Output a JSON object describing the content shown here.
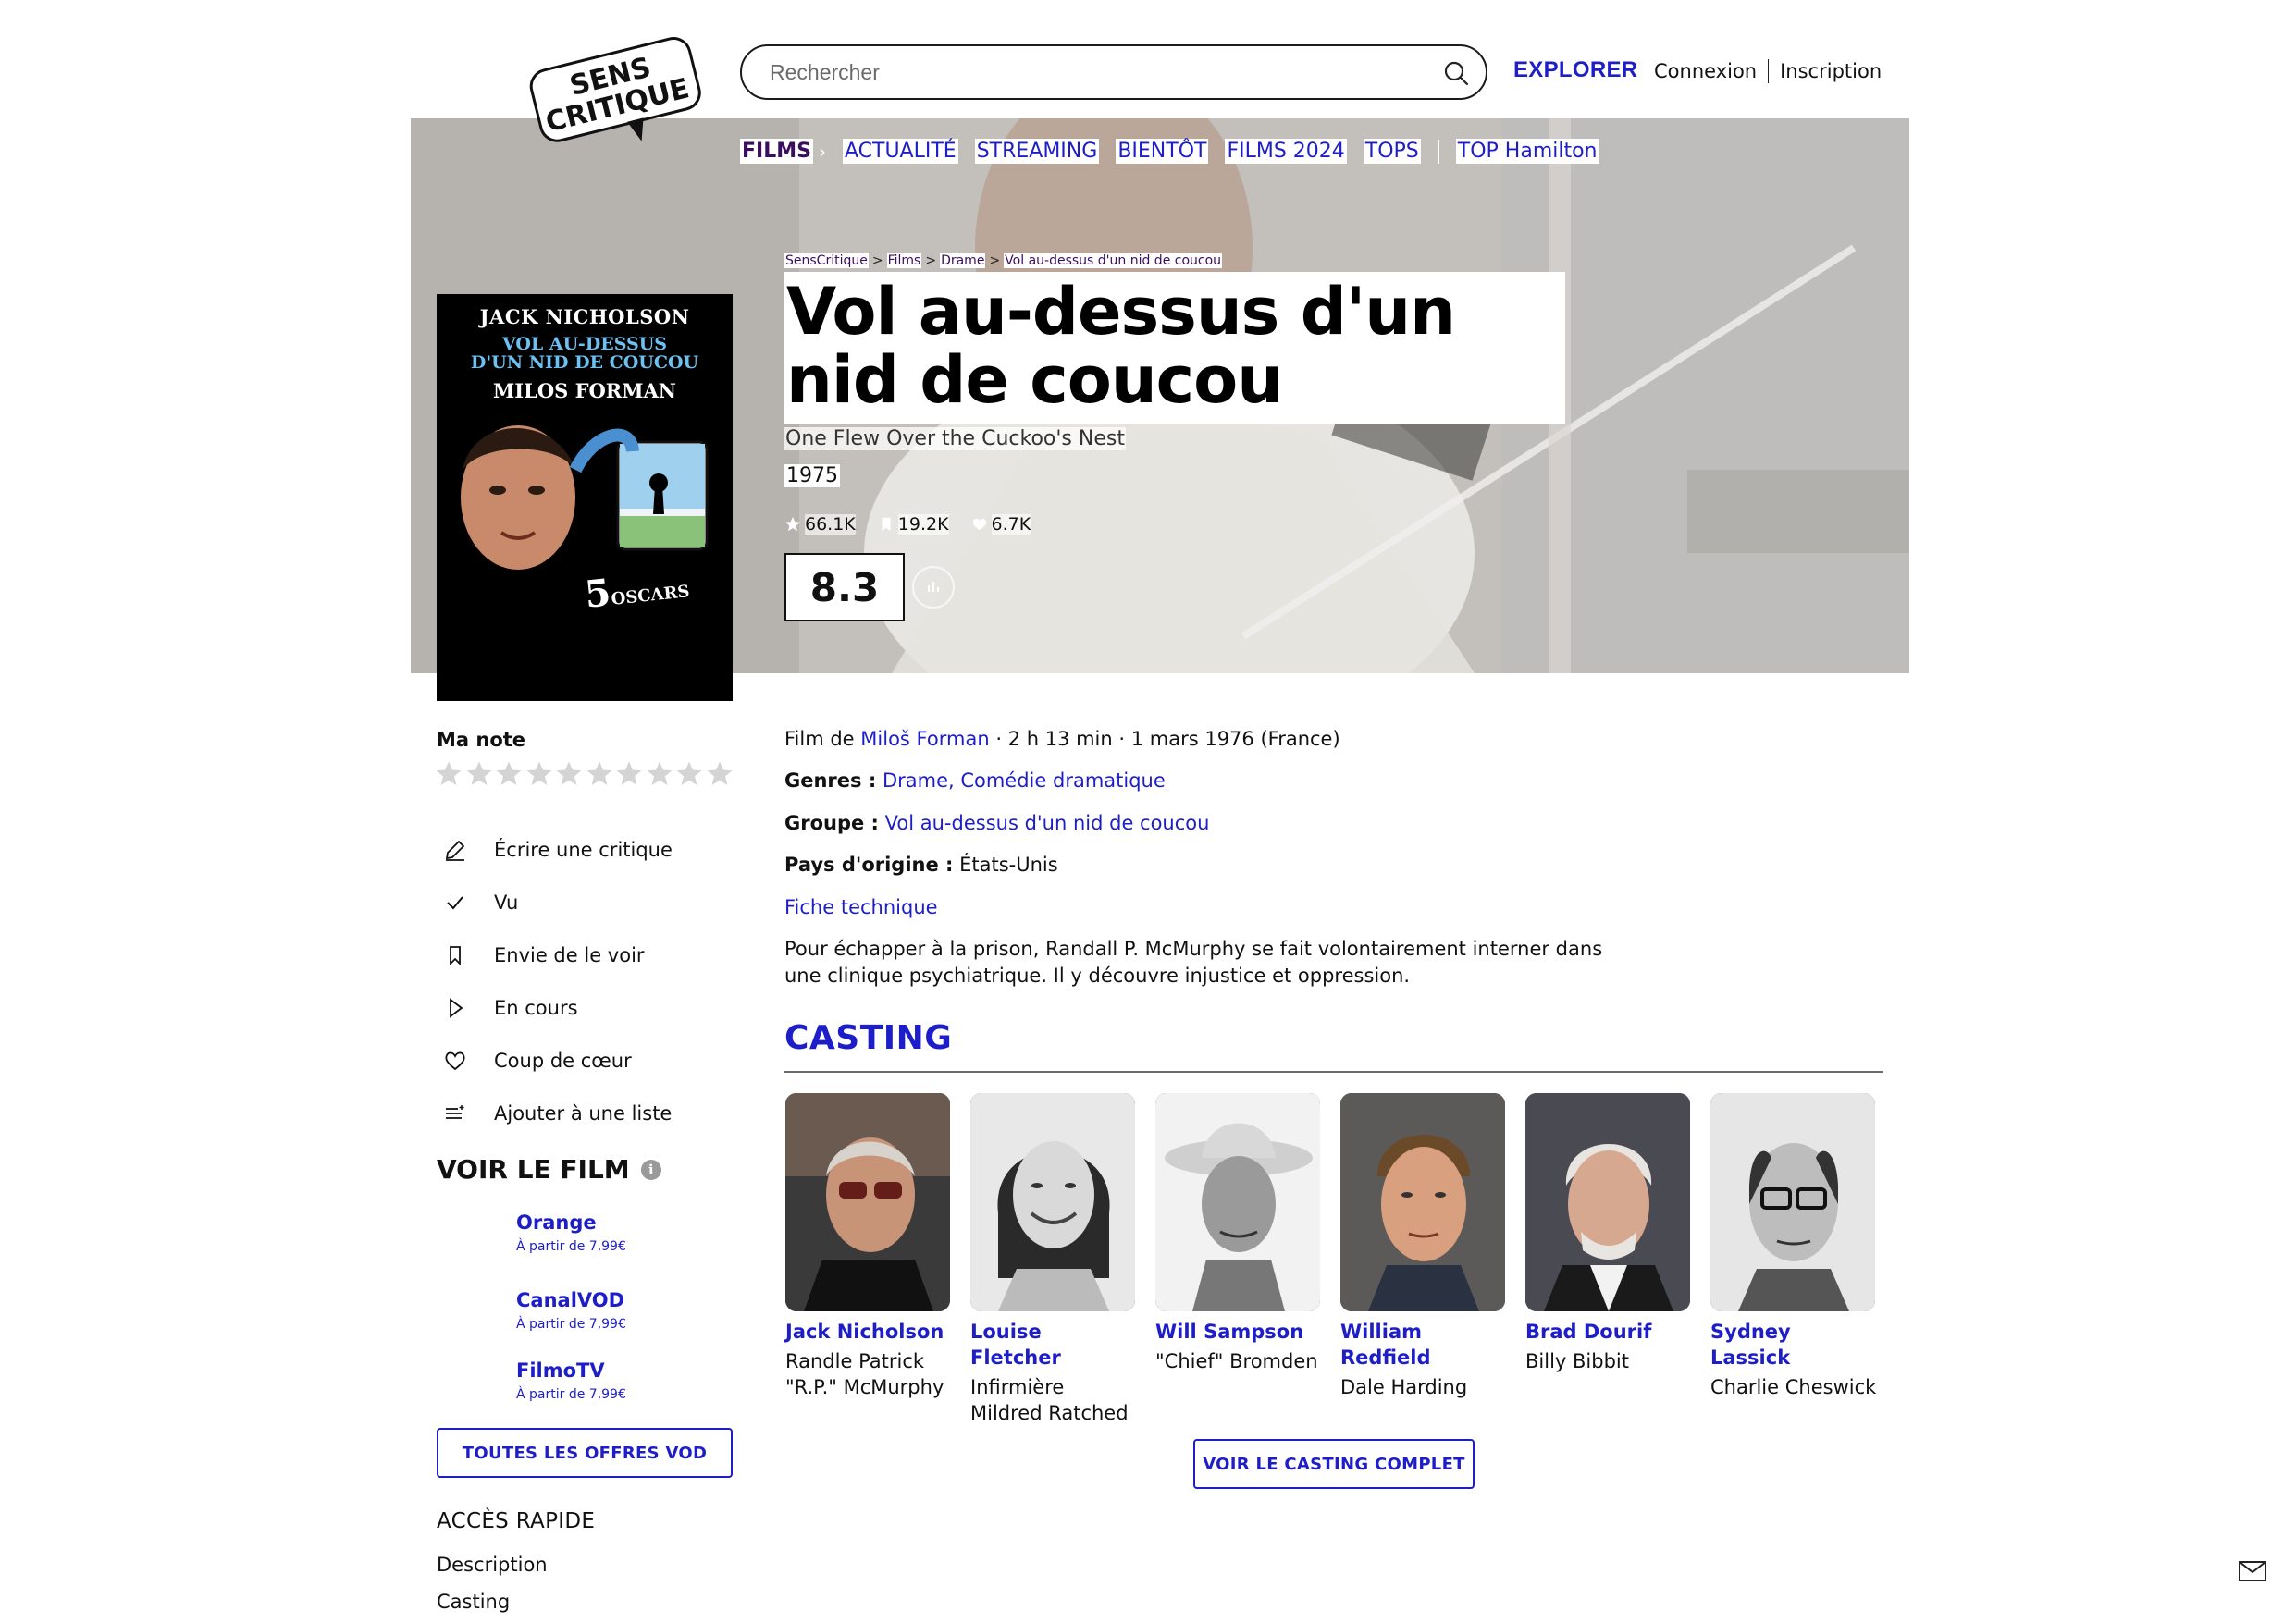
{
  "header": {
    "logo_text_top": "SENS",
    "logo_text_bottom": "CRITIQUE",
    "search_placeholder": "Rechercher",
    "explore_label": "EXPLORER",
    "login_label": "Connexion",
    "signup_label": "Inscription"
  },
  "nav": {
    "items": [
      "FILMS",
      "ACTUALITÉ",
      "STREAMING",
      "BIENTÔT",
      "FILMS 2024",
      "TOPS",
      "TOP Hamilton"
    ]
  },
  "breadcrumb": [
    "SensCritique",
    "Films",
    "Drame",
    "Vol au-dessus d'un nid de coucou"
  ],
  "film": {
    "title": "Vol au-dessus d'un nid de coucou",
    "original_title": "One Flew Over the Cuckoo's Nest",
    "year": "1975",
    "stats": {
      "ratings": "66.1K",
      "wishes": "19.2K",
      "favorites": "6.7K"
    },
    "score": "8.3"
  },
  "poster": {
    "actor": "JACK NICHOLSON",
    "title_line1": "VOL AU-DESSUS",
    "title_line2": "D'UN NID DE COUCOU",
    "director": "MILOS FORMAN",
    "oscars_number": "5",
    "oscars_label": "OSCARS"
  },
  "my_rating": {
    "label": "Ma note",
    "stars": 10
  },
  "actions": [
    {
      "label": "Écrire une critique",
      "icon": "pencil-icon"
    },
    {
      "label": "Vu",
      "icon": "check-icon"
    },
    {
      "label": "Envie de le voir",
      "icon": "bookmark-icon"
    },
    {
      "label": "En cours",
      "icon": "play-icon"
    },
    {
      "label": "Coup de cœur",
      "icon": "heart-icon"
    },
    {
      "label": "Ajouter à une liste",
      "icon": "list-add-icon"
    }
  ],
  "watch": {
    "title": "VOIR LE FILM",
    "offers": [
      {
        "name": "Orange",
        "price": "À partir de 7,99€"
      },
      {
        "name": "CanalVOD",
        "price": "À partir de 7,99€"
      },
      {
        "name": "FilmoTV",
        "price": "À partir de 7,99€"
      }
    ],
    "all_offers_label": "TOUTES LES OFFRES VOD"
  },
  "quick_access": {
    "title": "ACCÈS RAPIDE",
    "links": [
      "Description",
      "Casting"
    ]
  },
  "details": {
    "film_by_prefix": "Film de",
    "director": "Miloš Forman",
    "meta": "· 2 h 13 min · 1 mars 1976 (France)",
    "genres_label": "Genres :",
    "genres": "Drame, Comédie dramatique",
    "group_label": "Groupe :",
    "group": "Vol au-dessus d'un nid de coucou",
    "country_label": "Pays d'origine :",
    "country": "États-Unis",
    "tech_sheet": "Fiche technique",
    "synopsis": "Pour échapper à la prison, Randall P. McMurphy se fait volontairement interner dans une clinique psychiatrique. Il y découvre injustice et oppression."
  },
  "casting": {
    "title": "CASTING",
    "cast": [
      {
        "name": "Jack Nicholson",
        "role": "Randle Patrick \"R.P.\" McMurphy"
      },
      {
        "name": "Louise Fletcher",
        "role": "Infirmière Mildred Ratched"
      },
      {
        "name": "Will Sampson",
        "role": "\"Chief\" Bromden"
      },
      {
        "name": "William Redfield",
        "role": "Dale Harding"
      },
      {
        "name": "Brad Dourif",
        "role": "Billy Bibbit"
      },
      {
        "name": "Sydney Lassick",
        "role": "Charlie Cheswick"
      }
    ],
    "see_all_label": "VOIR LE CASTING COMPLET"
  },
  "colors": {
    "accent": "#1e1ec9",
    "nav_active": "#3a0d5e"
  }
}
